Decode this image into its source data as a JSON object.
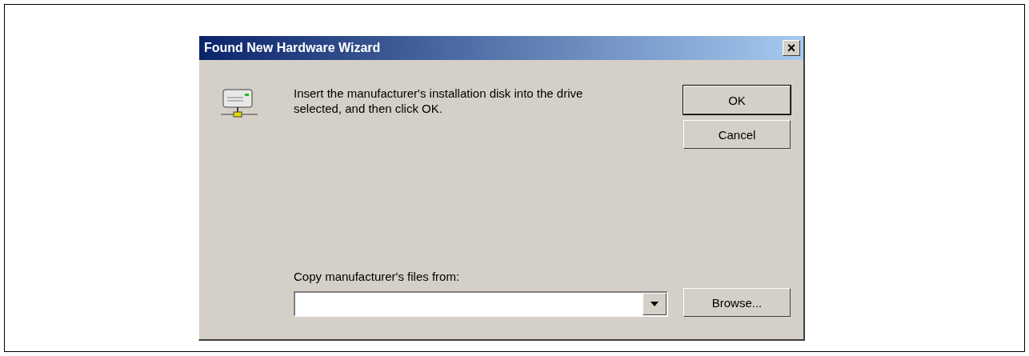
{
  "window": {
    "title": "Found New Hardware Wizard",
    "close": "×"
  },
  "message": "Insert the manufacturer's installation disk into the drive selected, and then click OK.",
  "buttons": [
    {
      "label": "OK",
      "default": true
    },
    {
      "label": "Cancel",
      "default": false
    }
  ],
  "source": {
    "label": "Copy manufacturer's files from:",
    "browse": "Browse..."
  }
}
